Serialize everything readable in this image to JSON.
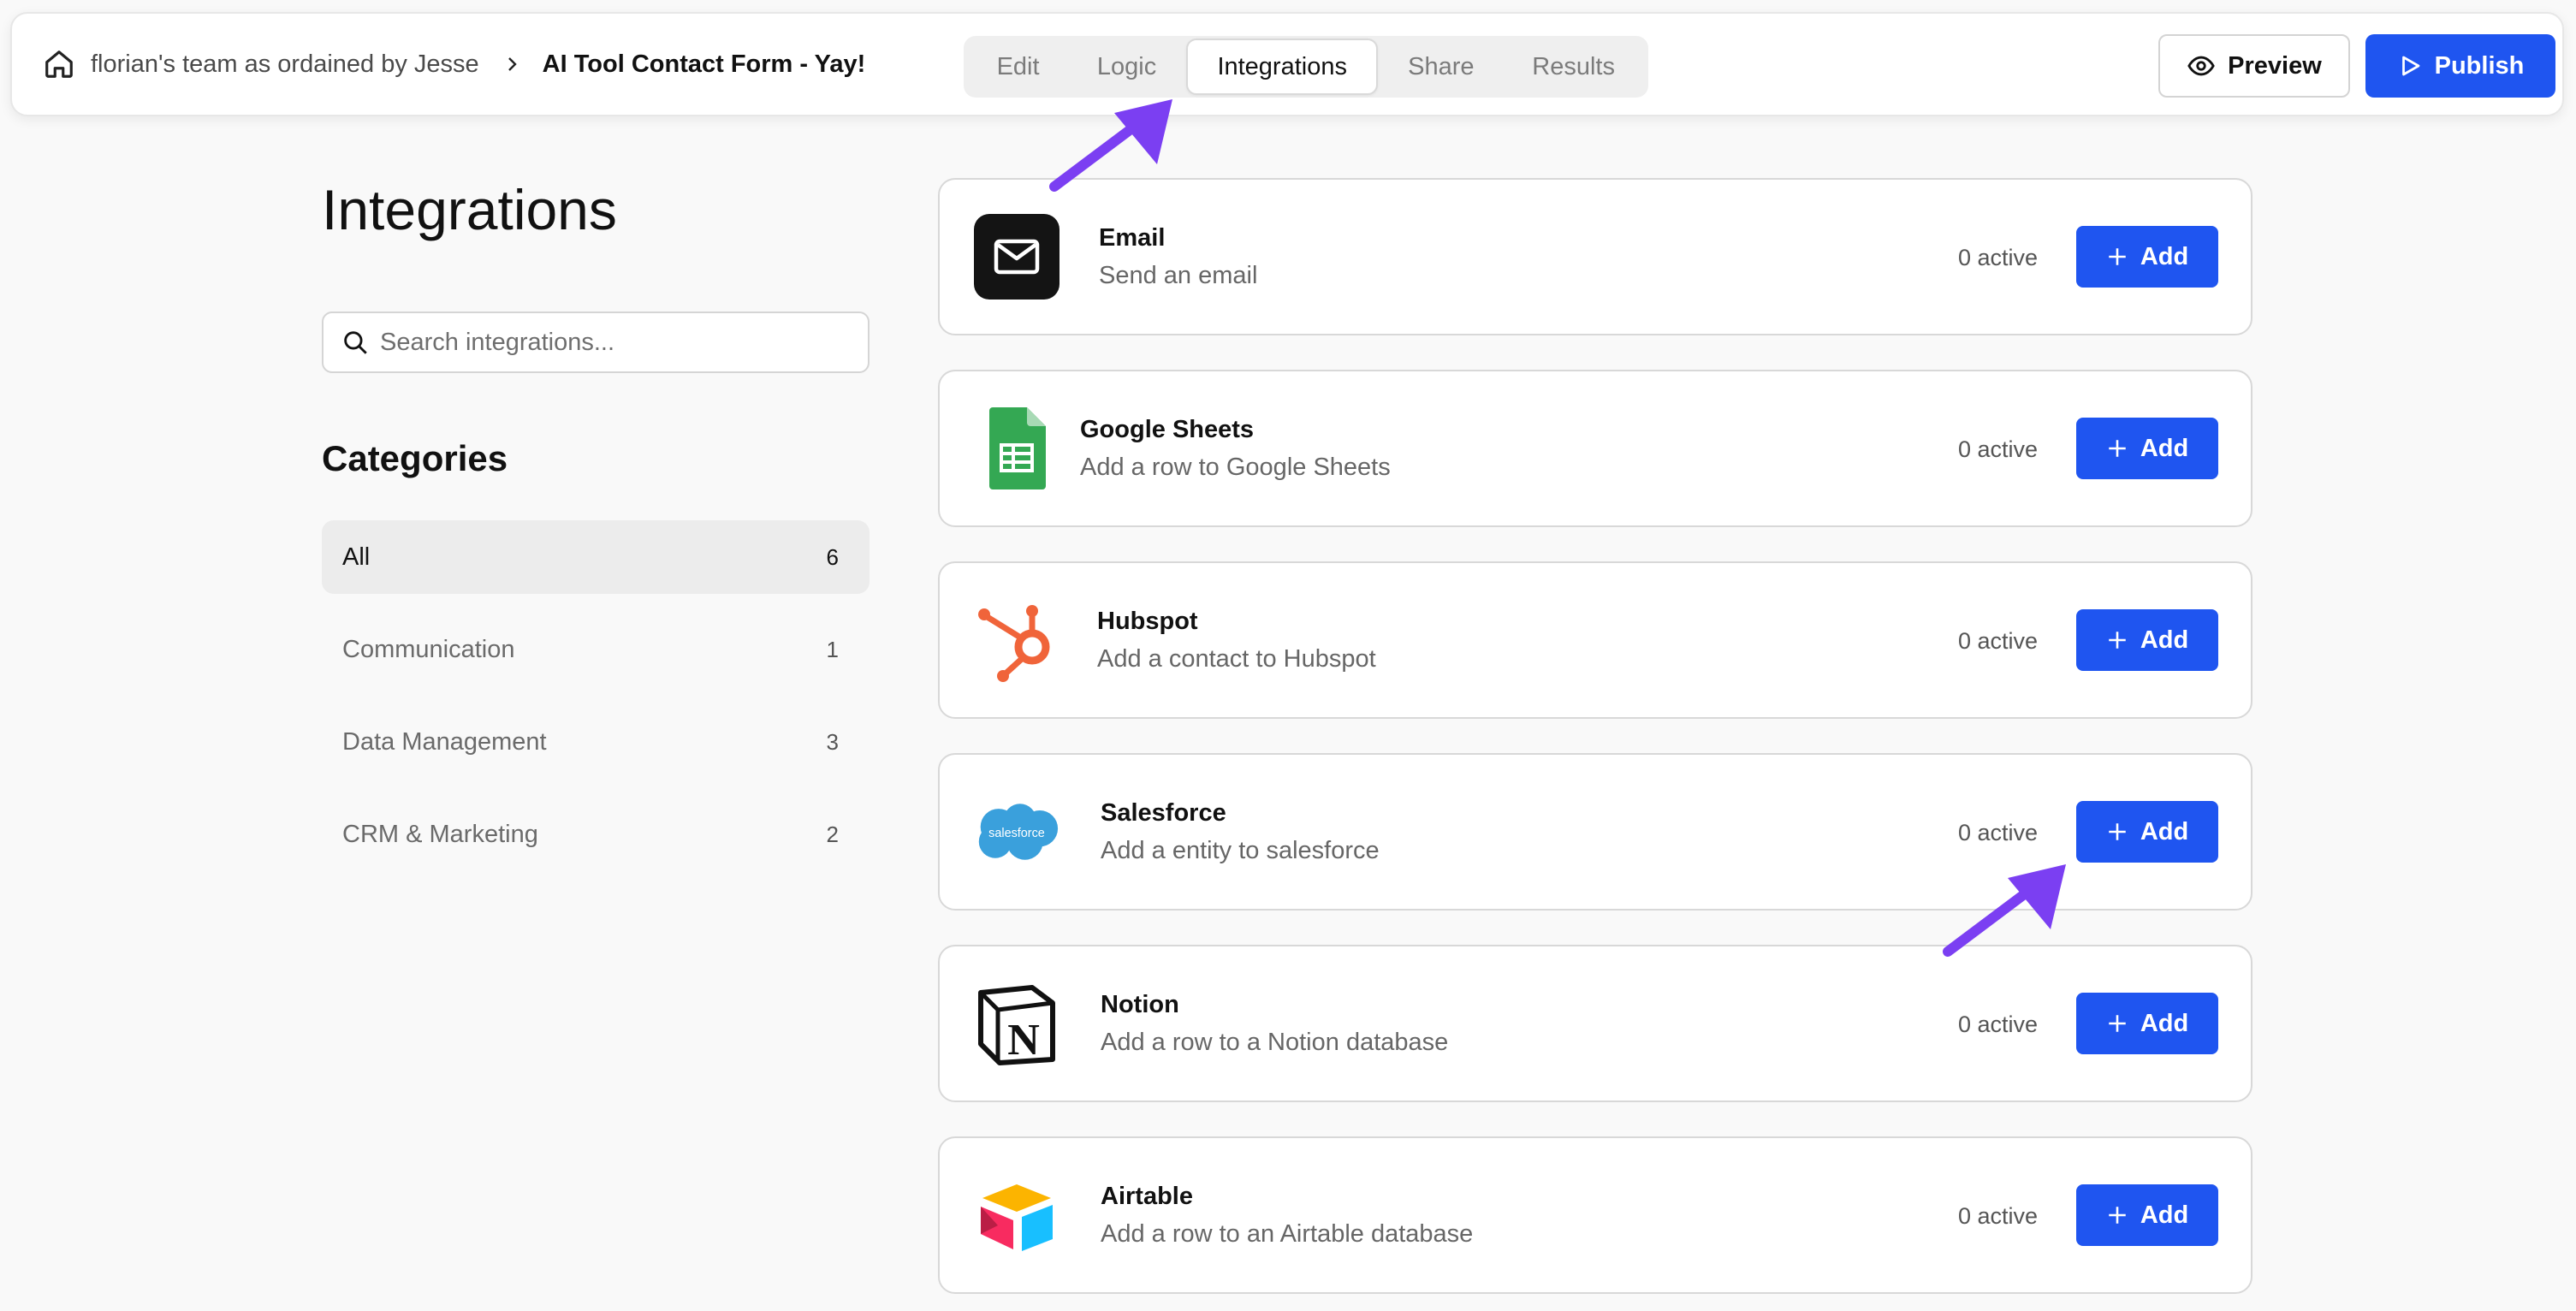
{
  "header": {
    "team": "florian's team as ordained by Jesse",
    "form_title": "AI Tool Contact Form - Yay!",
    "tabs": [
      "Edit",
      "Logic",
      "Integrations",
      "Share",
      "Results"
    ],
    "active_tab": "Integrations",
    "preview_label": "Preview",
    "publish_label": "Publish"
  },
  "sidebar": {
    "title": "Integrations",
    "search_placeholder": "Search integrations...",
    "categories_title": "Categories",
    "categories": [
      {
        "label": "All",
        "count": "6",
        "active": true
      },
      {
        "label": "Communication",
        "count": "1"
      },
      {
        "label": "Data Management",
        "count": "3"
      },
      {
        "label": "CRM & Marketing",
        "count": "2"
      }
    ]
  },
  "integrations": [
    {
      "name": "Email",
      "desc": "Send an email",
      "status": "0 active",
      "action": "Add",
      "icon": "envelope-icon"
    },
    {
      "name": "Google Sheets",
      "desc": "Add a row to Google Sheets",
      "status": "0 active",
      "action": "Add",
      "icon": "google-sheets-icon"
    },
    {
      "name": "Hubspot",
      "desc": "Add a contact to Hubspot",
      "status": "0 active",
      "action": "Add",
      "icon": "hubspot-icon"
    },
    {
      "name": "Salesforce",
      "desc": "Add a entity to salesforce",
      "status": "0 active",
      "action": "Add",
      "icon": "salesforce-icon",
      "logo_text": "salesforce"
    },
    {
      "name": "Notion",
      "desc": "Add a row to a Notion database",
      "status": "0 active",
      "action": "Add",
      "icon": "notion-icon",
      "logo_text": "N"
    },
    {
      "name": "Airtable",
      "desc": "Add a row to an Airtable database",
      "status": "0 active",
      "action": "Add",
      "icon": "airtable-icon"
    }
  ],
  "colors": {
    "accent": "#1f55f0",
    "annotation_arrow": "#7b3ff2",
    "hubspot": "#f0643a",
    "sheets": "#34a853",
    "salesforce": "#3aa0dc"
  }
}
